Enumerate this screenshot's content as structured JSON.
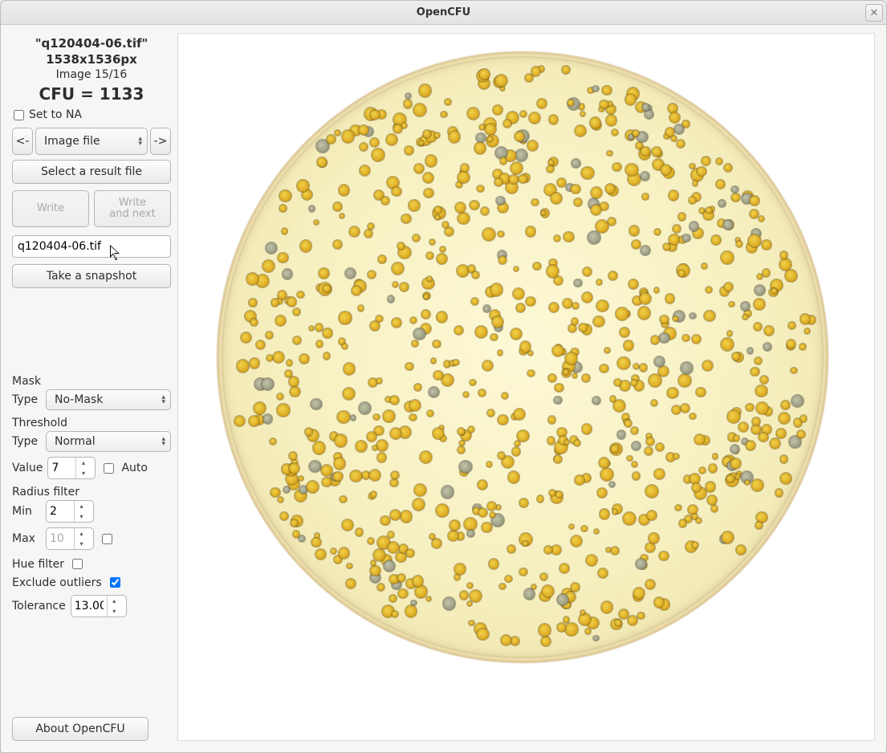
{
  "app_title": "OpenCFU",
  "info": {
    "filename_display": "\"q120404-06.tif\"",
    "dimensions": "1538x1536px",
    "image_index": "Image 15/16",
    "cfu_line": "CFU = 1133"
  },
  "set_to_na": {
    "label": "Set to NA",
    "checked": false
  },
  "nav": {
    "prev_label": "<-",
    "combo_label": "Image file",
    "next_label": "->"
  },
  "buttons": {
    "select_result": "Select a result file",
    "write": "Write",
    "write_and_next": "Write\nand next",
    "snapshot": "Take a snapshot",
    "about": "About OpenCFU"
  },
  "filename_field": "q120404-06.tif",
  "mask": {
    "section": "Mask",
    "type_label": "Type",
    "type_value": "No-Mask"
  },
  "threshold": {
    "section": "Threshold",
    "type_label": "Type",
    "type_value": "Normal",
    "value_label": "Value",
    "value": "7",
    "auto_label": "Auto",
    "auto_checked": false
  },
  "radius": {
    "section": "Radius filter",
    "min_label": "Min",
    "min_value": "2",
    "max_label": "Max",
    "max_value": "10",
    "max_enabled": false,
    "max_check": false
  },
  "hue": {
    "label": "Hue filter",
    "checked": false
  },
  "outliers": {
    "label": "Exclude outliers",
    "checked": true
  },
  "tolerance": {
    "label": "Tolerance",
    "value": "13.00"
  }
}
